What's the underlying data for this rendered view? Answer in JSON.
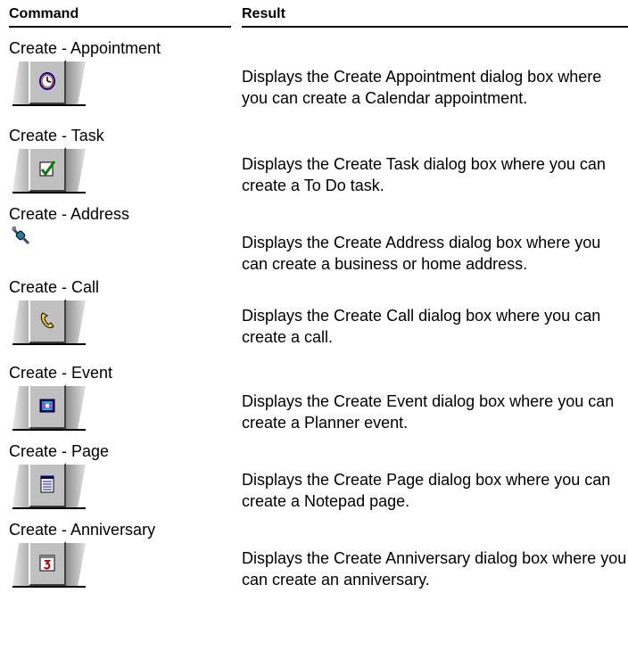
{
  "header": {
    "command": "Command",
    "result": "Result"
  },
  "rows": [
    {
      "command": "Create - Appointment",
      "icon": "clock-icon",
      "result": "Displays the Create Appointment dialog box where you can create a Calendar appointment."
    },
    {
      "command": "Create - Task",
      "icon": "checkmark-icon",
      "result": "Displays the Create Task dialog box where you can create a To Do task."
    },
    {
      "command": "Create - Address",
      "icon": "address-link-icon",
      "result": "Displays the Create Address dialog box where you can create a business or home address."
    },
    {
      "command": "Create - Call",
      "icon": "phone-icon",
      "result": "Displays the Create Call dialog box where you can create a call."
    },
    {
      "command": "Create - Event",
      "icon": "event-icon",
      "result": "Displays the Create Event dialog box where you can create a Planner event."
    },
    {
      "command": "Create - Page",
      "icon": "notepad-page-icon",
      "result": "Displays the Create Page dialog box where you can create a Notepad page."
    },
    {
      "command": "Create - Anniversary",
      "icon": "anniversary-calendar-icon",
      "result": "Displays the Create Anniversary dialog box where you can create an anniversary."
    }
  ]
}
